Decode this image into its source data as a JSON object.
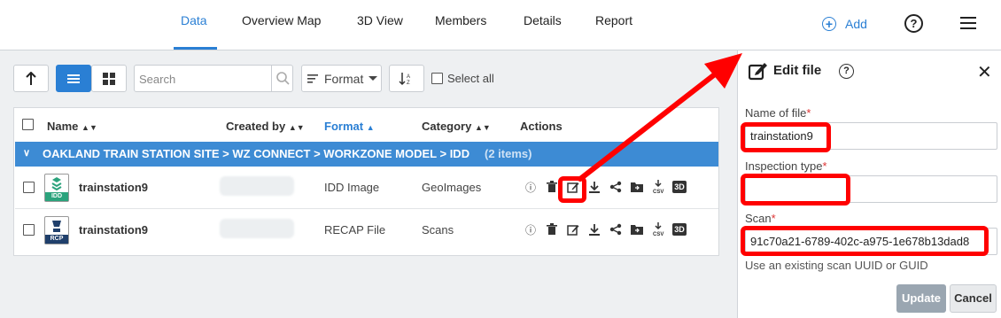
{
  "tabs": [
    {
      "label": "Data",
      "active": true
    },
    {
      "label": "Overview Map"
    },
    {
      "label": "3D View"
    },
    {
      "label": "Members"
    },
    {
      "label": "Details"
    },
    {
      "label": "Report"
    }
  ],
  "header": {
    "add_label": "Add"
  },
  "toolbar": {
    "search_placeholder": "Search",
    "format_label": "Format",
    "select_all_label": "Select all"
  },
  "table": {
    "columns": [
      "Name",
      "Created by",
      "Format",
      "Category",
      "Actions"
    ],
    "group_path": "OAKLAND TRAIN STATION SITE > WZ CONNECT > WORKZONE MODEL > IDD",
    "group_count": "(2 items)",
    "rows": [
      {
        "name": "trainstation9",
        "icon_label": "IDD",
        "format": "IDD Image",
        "category": "GeoImages"
      },
      {
        "name": "trainstation9",
        "icon_label": "RCP",
        "format": "RECAP File",
        "category": "Scans"
      }
    ]
  },
  "panel": {
    "title": "Edit file",
    "name_label": "Name of file",
    "name_value": "trainstation9",
    "inspection_label": "Inspection type",
    "inspection_value": "",
    "scan_label": "Scan",
    "scan_value": "91c70a21-6789-402c-a975-1e678b13dad8",
    "scan_hint": "Use an existing scan UUID or GUID",
    "update_label": "Update",
    "cancel_label": "Cancel",
    "required_mark": "*"
  },
  "colors": {
    "accent": "#2a7fd4",
    "group_bar": "#3d8bd4",
    "highlight": "#ff0000"
  }
}
